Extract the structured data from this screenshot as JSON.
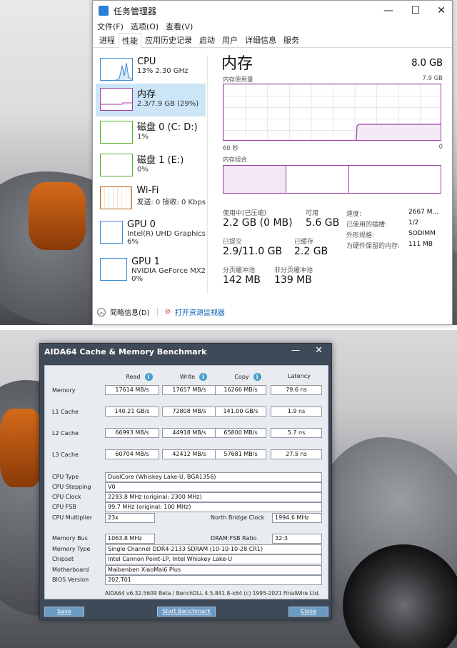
{
  "task_manager": {
    "title": "任务管理器",
    "menu": [
      "文件(F)",
      "选项(O)",
      "查看(V)"
    ],
    "tabs": [
      "进程",
      "性能",
      "应用历史记录",
      "启动",
      "用户",
      "详细信息",
      "服务"
    ],
    "active_tab": 1,
    "sidebar": [
      {
        "name": "CPU",
        "sub": "13% 2.30 GHz",
        "color": "#3b8ad8"
      },
      {
        "name": "内存",
        "sub": "2.3/7.9 GB (29%)",
        "color": "#9b3fa4"
      },
      {
        "name": "磁盘 0 (C: D:)",
        "sub": "1%",
        "color": "#4caf28"
      },
      {
        "name": "磁盘 1 (E:)",
        "sub": "0%",
        "color": "#4caf28"
      },
      {
        "name": "Wi-Fi",
        "sub": "发送: 0 接收: 0 Kbps",
        "color": "#b8651b"
      },
      {
        "name": "GPU 0",
        "sub": "Intel(R) UHD Graphics",
        "sub2": "6%",
        "color": "#3b8ad8"
      },
      {
        "name": "GPU 1",
        "sub": "NVIDIA GeForce MX2",
        "sub2": "0%",
        "color": "#3b8ad8"
      }
    ],
    "main": {
      "title": "内存",
      "total": "8.0 GB",
      "usage_label": "内存使用量",
      "usage_max": "7.9 GB",
      "axis_left": "60 秒",
      "axis_right": "0",
      "composition_label": "内存组合",
      "in_use_label": "使用中(已压缩)",
      "in_use_value": "2.2 GB (0 MB)",
      "available_label": "可用",
      "available_value": "5.6 GB",
      "committed_label": "已提交",
      "committed_value": "2.9/11.0 GB",
      "cached_label": "已缓存",
      "cached_value": "2.2 GB",
      "paged_label": "分页缓冲池",
      "paged_value": "142 MB",
      "nonpaged_label": "非分页缓冲池",
      "nonpaged_value": "139 MB",
      "speed_label": "速度:",
      "speed_value": "2667 M...",
      "slots_label": "已使用的插槽:",
      "slots_value": "1/2",
      "form_label": "外形规格:",
      "form_value": "SODIMM",
      "reserved_label": "为硬件保留的内存:",
      "reserved_value": "111 MB"
    },
    "footer": {
      "summary": "简略信息(D)",
      "monitor": "打开资源监视器"
    }
  },
  "aida": {
    "title": "AIDA64 Cache & Memory Benchmark",
    "headers": [
      "Read",
      "Write",
      "Copy",
      "Latency"
    ],
    "rows": [
      {
        "label": "Memory",
        "values": [
          "17614 MB/s",
          "17657 MB/s",
          "16266 MB/s",
          "79.6 ns"
        ]
      },
      {
        "label": "L1 Cache",
        "values": [
          "140.21 GB/s",
          "72808 MB/s",
          "141.00 GB/s",
          "1.9 ns"
        ]
      },
      {
        "label": "L2 Cache",
        "values": [
          "66993 MB/s",
          "44918 MB/s",
          "65800 MB/s",
          "5.7 ns"
        ]
      },
      {
        "label": "L3 Cache",
        "values": [
          "60704 MB/s",
          "42412 MB/s",
          "57681 MB/s",
          "27.5 ns"
        ]
      }
    ],
    "cpu_type_label": "CPU Type",
    "cpu_type": "DualCore   (Whiskey Lake-U, BGA1356)",
    "cpu_stepping_label": "CPU Stepping",
    "cpu_stepping": "V0",
    "cpu_clock_label": "CPU Clock",
    "cpu_clock": "2293.8 MHz  (original: 2300 MHz)",
    "cpu_fsb_label": "CPU FSB",
    "cpu_fsb": "99.7 MHz  (original: 100 MHz)",
    "cpu_mult_label": "CPU Multiplier",
    "cpu_mult": "23x",
    "nb_clock_label": "North Bridge Clock",
    "nb_clock": "1994.6 MHz",
    "mem_bus_label": "Memory Bus",
    "mem_bus": "1063.8 MHz",
    "dram_ratio_label": "DRAM:FSB Ratio",
    "dram_ratio": "32:3",
    "mem_type_label": "Memory Type",
    "mem_type": "Single Channel DDR4-2133 SDRAM  (10-10-10-28 CR1)",
    "chipset_label": "Chipset",
    "chipset": "Intel Cannon Point-LP, Intel Whiskey Lake-U",
    "mobo_label": "Motherboard",
    "mobo": "Maibenben XiaoMai6 Plus",
    "bios_label": "BIOS Version",
    "bios": "202.T01",
    "version": "AIDA64 v6.32.5609 Beta / BenchDLL 4.5.841.8-x64  (c) 1995-2021 FinalWire Ltd.",
    "save": "Save",
    "start": "Start Benchmark",
    "close": "Close"
  }
}
